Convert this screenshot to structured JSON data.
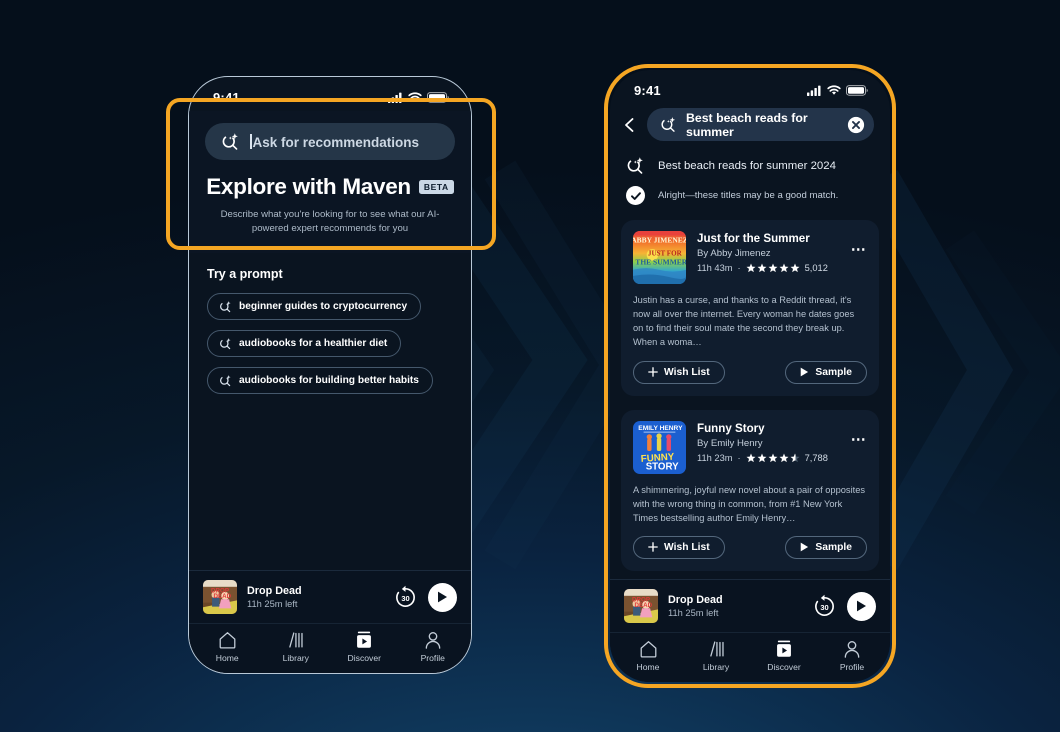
{
  "background": {
    "top_color": "#040c16",
    "bottom_color": "#11406a",
    "accent_color": "#f5a623"
  },
  "left_phone": {
    "status_bar": {
      "time": "9:41",
      "cellular_icon": "signal-bars-icon",
      "wifi_icon": "wifi-icon",
      "battery_icon": "battery-icon"
    },
    "maven_panel": {
      "search_icon": "maven-sparkle-search-icon",
      "search_placeholder": "Ask for recommendations",
      "title": "Explore with Maven",
      "badge": "BETA",
      "subtitle": "Describe what you're looking for to see what our AI-powered expert recommends for you"
    },
    "try_section": {
      "heading": "Try a prompt",
      "chips": [
        {
          "icon": "maven-sparkle-search-icon",
          "label": "beginner guides to cryptocurrency"
        },
        {
          "icon": "maven-sparkle-search-icon",
          "label": "audiobooks for a healthier diet"
        },
        {
          "icon": "maven-sparkle-search-icon",
          "label": "audiobooks for building better habits"
        }
      ]
    },
    "player": {
      "cover_alt": "drop-dead-cover",
      "title": "Drop Dead",
      "time_left": "11h 25m left",
      "rewind_label": "30",
      "rewind_icon": "rewind-30-icon",
      "play_icon": "play-icon"
    },
    "tabs": [
      {
        "icon": "home-icon",
        "label": "Home"
      },
      {
        "icon": "library-icon",
        "label": "Library"
      },
      {
        "icon": "discover-icon",
        "label": "Discover"
      },
      {
        "icon": "profile-icon",
        "label": "Profile"
      }
    ]
  },
  "right_phone": {
    "status_bar": {
      "time": "9:41",
      "cellular_icon": "signal-bars-icon",
      "wifi_icon": "wifi-icon",
      "battery_icon": "battery-icon"
    },
    "header": {
      "back_icon": "back-chevron-icon",
      "search_icon": "maven-sparkle-search-icon",
      "search_value": "Best beach reads for summer",
      "clear_icon": "clear-x-icon"
    },
    "conversation": {
      "query_icon": "maven-sparkle-search-icon",
      "query": "Best beach reads for summer 2024",
      "answer_icon": "check-circle-icon",
      "answer": "Alright—these titles may be a good match."
    },
    "books": [
      {
        "cover_alt": "just-for-the-summer-cover",
        "title": "Just for the Summer",
        "author": "By Abby Jimenez",
        "duration": "11h 43m",
        "separator": "·",
        "stars": 5,
        "rating_count": "5,012",
        "description": "Justin has a curse, and thanks to a Reddit thread, it's now all over the internet. Every woman he dates goes on to find their soul mate the second they break up. When a woma…",
        "wish_list_label": "Wish List",
        "wish_list_icon": "plus-icon",
        "sample_label": "Sample",
        "sample_icon": "play-icon",
        "more_icon": "more-dots-icon"
      },
      {
        "cover_alt": "funny-story-cover",
        "title": "Funny Story",
        "author": "By Emily Henry",
        "duration": "11h 23m",
        "separator": "·",
        "stars": 4.5,
        "rating_count": "7,788",
        "description": "A shimmering, joyful new novel about a pair of opposites with the wrong thing in common, from #1 New York Times bestselling author Emily Henry…",
        "wish_list_label": "Wish List",
        "wish_list_icon": "plus-icon",
        "sample_label": "Sample",
        "sample_icon": "play-icon",
        "more_icon": "more-dots-icon"
      }
    ],
    "player": {
      "cover_alt": "drop-dead-cover",
      "title": "Drop Dead",
      "time_left": "11h 25m left",
      "rewind_label": "30",
      "rewind_icon": "rewind-30-icon",
      "play_icon": "play-icon"
    },
    "tabs": [
      {
        "icon": "home-icon",
        "label": "Home"
      },
      {
        "icon": "library-icon",
        "label": "Library"
      },
      {
        "icon": "discover-icon",
        "label": "Discover"
      },
      {
        "icon": "profile-icon",
        "label": "Profile"
      }
    ]
  }
}
